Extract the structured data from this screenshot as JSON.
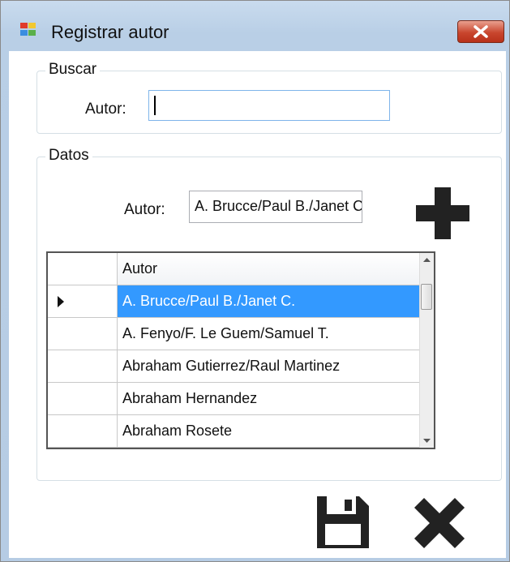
{
  "window": {
    "title": "Registrar autor",
    "close_icon": "close-icon"
  },
  "buscar": {
    "group_label": "Buscar",
    "field_label": "Autor:",
    "input_value": ""
  },
  "datos": {
    "group_label": "Datos",
    "field_label": "Autor:",
    "input_value": "A. Brucce/Paul B./Janet C.",
    "add_icon": "plus-icon"
  },
  "grid": {
    "column_header": "Autor",
    "rows": [
      "A. Brucce/Paul B./Janet C.",
      "A. Fenyo/F.  Le Guem/Samuel T.",
      "Abraham Gutierrez/Raul Martinez",
      "Abraham Hernandez",
      "Abraham Rosete"
    ],
    "selected_row": 0
  },
  "actions": {
    "save_icon": "save-icon",
    "cancel_icon": "cancel-icon"
  },
  "colors": {
    "selection": "#3399ff",
    "titlebar": "#c9dbee",
    "close_button": "#c9462e"
  }
}
